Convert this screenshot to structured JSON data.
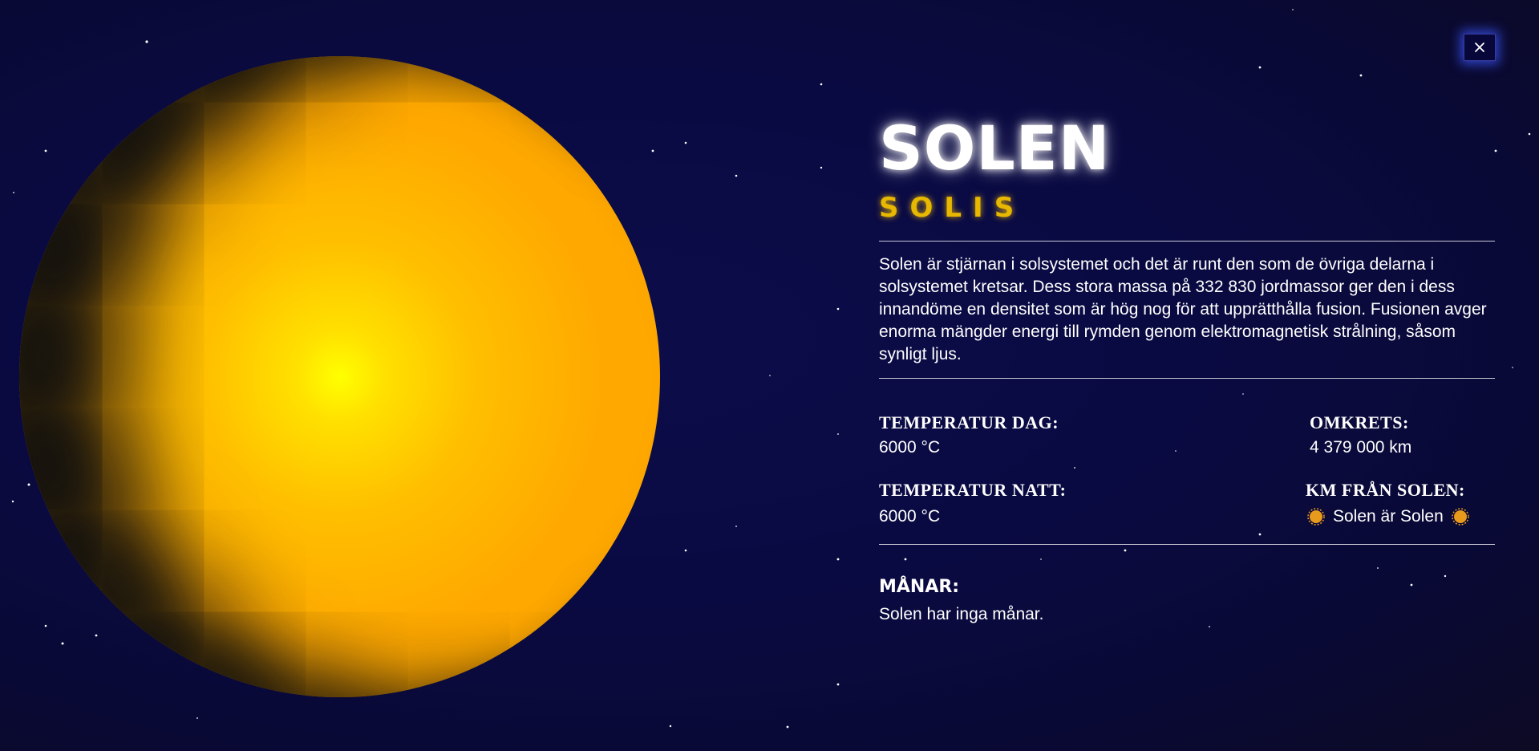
{
  "planet": {
    "name": "SOLEN",
    "latin_name": "SOLIS",
    "description": "Solen är stjärnan i solsystemet och det är runt den som de övriga delarna i solsystemet kretsar. Dess stora massa på 332 830 jordmassor ger den i dess innandöme en densitet som är hög nog för att upprätthålla fusion. Fusionen avger enorma mängder energi till rymden genom elektromagnetisk strålning, såsom synligt ljus."
  },
  "stats": {
    "temp_day_label": "TEMPERATUR DAG:",
    "temp_day_value": "6000 °C",
    "temp_night_label": "TEMPERATUR NATT:",
    "temp_night_value": "6000 °C",
    "circumference_label": "OMKRETS:",
    "circumference_value": "4 379 000 km",
    "distance_label": "KM FRÅN SOLEN:",
    "distance_value": "Solen är Solen",
    "distance_icon": "sun-icon"
  },
  "moons": {
    "label": "MÅNAR:",
    "value": "Solen har inga månar."
  },
  "close_button": {
    "icon": "close-icon"
  },
  "colors": {
    "background": "#0a0a42",
    "planet": "#ffa900",
    "planet_core": "#ffff00",
    "subtitle": "#e8b800",
    "close_glow": "#3c5aff",
    "sun_icon": "#e89a1c"
  }
}
